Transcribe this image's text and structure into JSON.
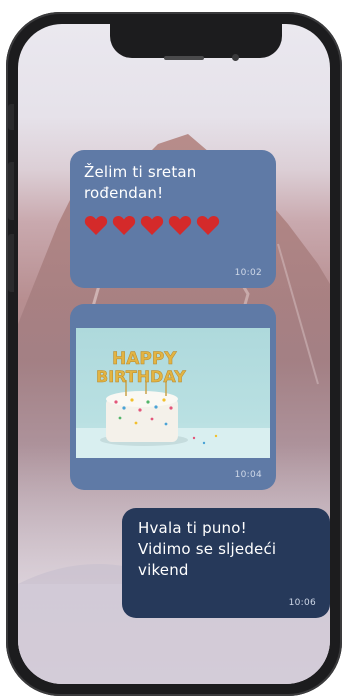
{
  "messages": [
    {
      "text_line1": "Želim ti sretan",
      "text_line2": "rođendan!",
      "hearts": 5,
      "time": "10:02",
      "side": "left"
    },
    {
      "image_text_line1": "HAPPY",
      "image_text_line2": "BIRTHDAY",
      "time": "10:04",
      "side": "left"
    },
    {
      "text_line1": "Hvala ti puno!",
      "text_line2": "Vidimo se sljedeći",
      "text_line3": "vikend",
      "time": "10:06",
      "side": "right"
    }
  ],
  "colors": {
    "bubble_incoming": "#5f7aa6",
    "bubble_outgoing": "#26395a",
    "heart": "#d42a2a",
    "phone_frame": "#1c1c1e"
  },
  "icons": [
    "heart-icon"
  ]
}
